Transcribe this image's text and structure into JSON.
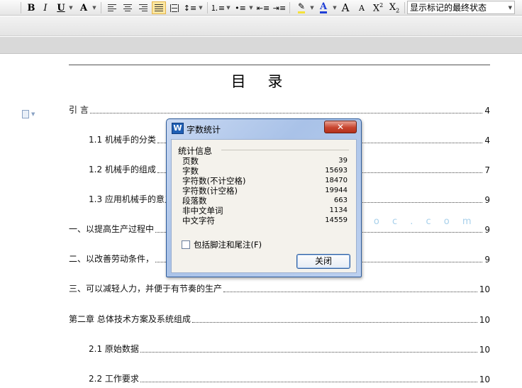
{
  "toolbar": {
    "bold": "B",
    "italic": "I",
    "underline": "U",
    "font_effects": "A",
    "grow_font": "A",
    "shrink_font": "A",
    "superscript": "X",
    "superscript_mark": "2",
    "subscript": "X",
    "subscript_mark": "2",
    "font_color": "A",
    "style_select_value": "显示标记的最终状态",
    "icons": [
      "bold-icon",
      "italic-icon",
      "underline-icon",
      "text-effects-icon",
      "align-left-icon",
      "align-center-icon",
      "align-right-icon",
      "justify-icon",
      "distributed-icon",
      "line-spacing-icon",
      "numbering-icon",
      "bullets-icon",
      "decrease-indent-icon",
      "increase-indent-icon",
      "highlight-icon",
      "font-color-icon",
      "grow-font-icon",
      "shrink-font-icon",
      "superscript-icon",
      "subscript-icon"
    ],
    "colors": {
      "highlight": "#f5e23a",
      "font_color": "#1f3fd6"
    }
  },
  "document": {
    "toc_title": "目 录",
    "toc": [
      {
        "text": "引 言",
        "page": "4"
      },
      {
        "text": "1.1  机械手的分类",
        "page": "4"
      },
      {
        "text": "1.2   机械手的组成",
        "page": "7"
      },
      {
        "text": "1.3    应用机械手的意义",
        "page": "9"
      },
      {
        "text": "一、以提高生产过程中",
        "page": "9"
      },
      {
        "text": "二、以改善劳动条件，",
        "page": "9"
      },
      {
        "text": "三、可以减轻人力，并便于有节奏的生产",
        "page": "10"
      },
      {
        "text": "第二章  总体技术方案及系统组成",
        "page": "10"
      },
      {
        "text": "2.1  原始数据",
        "page": "10"
      },
      {
        "text": "2.2 工作要求",
        "page": "10"
      }
    ],
    "watermark_url": "w w w . r e n r e n d o c . c o m"
  },
  "dialog": {
    "app_icon_letter": "W",
    "title": "字数统计",
    "close_x": "✕",
    "stats_legend": "统计信息",
    "stats": [
      {
        "label": "页数",
        "value": "39"
      },
      {
        "label": "字数",
        "value": "15693"
      },
      {
        "label": "字符数(不计空格)",
        "value": "18470"
      },
      {
        "label": "字符数(计空格)",
        "value": "19944"
      },
      {
        "label": "段落数",
        "value": "663"
      },
      {
        "label": "非中文单词",
        "value": "1134"
      },
      {
        "label": "中文字符",
        "value": "14559"
      }
    ],
    "include_footnotes_label": "包括脚注和尾注(F)",
    "include_footnotes_checked": false,
    "close_button": "关闭"
  }
}
